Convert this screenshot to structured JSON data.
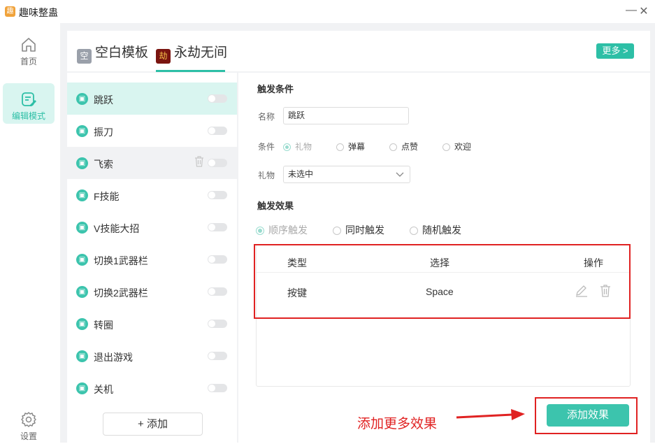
{
  "app": {
    "title": "趣味整蛊",
    "logo_glyph": "趣"
  },
  "window": {
    "minimize_glyph": "—",
    "close_glyph": "✕"
  },
  "sidebar": {
    "items": [
      {
        "label": "首页",
        "icon": "home-icon"
      },
      {
        "label": "编辑模式",
        "icon": "edit-icon",
        "active": true
      },
      {
        "label": "设置",
        "icon": "gear-icon"
      }
    ]
  },
  "header": {
    "tabs": [
      {
        "label": "空白模板",
        "badge": "空"
      },
      {
        "label": "永劫无间",
        "badge": "劫",
        "active": true
      }
    ],
    "more_label": "更多 >"
  },
  "trigger_list": {
    "items": [
      {
        "name": "跳跃",
        "enabled": false,
        "selected": true
      },
      {
        "name": "振刀",
        "enabled": false
      },
      {
        "name": "飞索",
        "enabled": false,
        "hovered": true
      },
      {
        "name": "F技能",
        "enabled": false
      },
      {
        "name": "V技能大招",
        "enabled": false
      },
      {
        "name": "切换1武器栏",
        "enabled": false
      },
      {
        "name": "切换2武器栏",
        "enabled": false
      },
      {
        "name": "转圈",
        "enabled": false
      },
      {
        "name": "退出游戏",
        "enabled": false
      },
      {
        "name": "关机",
        "enabled": false
      }
    ],
    "add_label": "+ 添加"
  },
  "detail": {
    "trigger_section_title": "触发条件",
    "name_label": "名称",
    "name_value": "跳跃",
    "condition_label": "条件",
    "conditions": [
      {
        "label": "礼物",
        "checked": true,
        "disabled": true
      },
      {
        "label": "弹幕",
        "checked": false
      },
      {
        "label": "点赞",
        "checked": false
      },
      {
        "label": "欢迎",
        "checked": false
      }
    ],
    "gift_label": "礼物",
    "gift_select_value": "未选中",
    "effect_section_title": "触发效果",
    "effect_modes": [
      {
        "label": "顺序触发",
        "checked": true,
        "disabled": true
      },
      {
        "label": "同时触发",
        "checked": false
      },
      {
        "label": "随机触发",
        "checked": false
      }
    ],
    "table": {
      "headers": [
        "类型",
        "选择",
        "操作"
      ],
      "rows": [
        {
          "type": "按键",
          "choice": "Space"
        }
      ]
    },
    "add_effect_label": "添加效果"
  },
  "annotation": {
    "text": "添加更多效果",
    "color": "#e02222"
  },
  "colors": {
    "accent": "#2dbfa6",
    "highlight_bg": "#d9f5f0",
    "annotation_red": "#e02222"
  }
}
